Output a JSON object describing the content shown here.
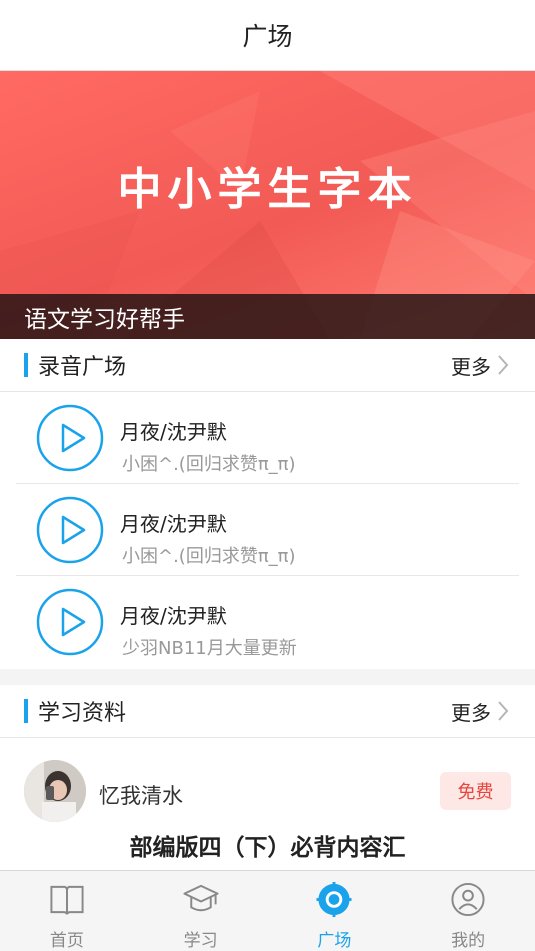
{
  "header": {
    "title": "广场"
  },
  "banner": {
    "title": "中小学生字本",
    "caption": "语文学习好帮手"
  },
  "recordings": {
    "section_title": "录音广场",
    "more_label": "更多",
    "items": [
      {
        "title": "月夜/沈尹默",
        "author": "小困^.(回归求赞π_π)"
      },
      {
        "title": "月夜/沈尹默",
        "author": "小困^.(回归求赞π_π)"
      },
      {
        "title": "月夜/沈尹默",
        "author": "少羽NB11月大量更新"
      }
    ]
  },
  "materials": {
    "section_title": "学习资料",
    "more_label": "更多",
    "items": [
      {
        "user": "忆我清水",
        "badge": "免费",
        "title": "部编版四（下）必背内容汇"
      }
    ]
  },
  "tabbar": {
    "tabs": [
      {
        "label": "首页",
        "icon": "book-icon",
        "active": false
      },
      {
        "label": "学习",
        "icon": "graduation-cap-icon",
        "active": false
      },
      {
        "label": "广场",
        "icon": "plaza-icon",
        "active": true
      },
      {
        "label": "我的",
        "icon": "user-icon",
        "active": false
      }
    ]
  },
  "colors": {
    "accent": "#1aa3ea",
    "banner": "#f25a55",
    "badge_text": "#e8453c",
    "badge_bg": "#fde8e6"
  }
}
